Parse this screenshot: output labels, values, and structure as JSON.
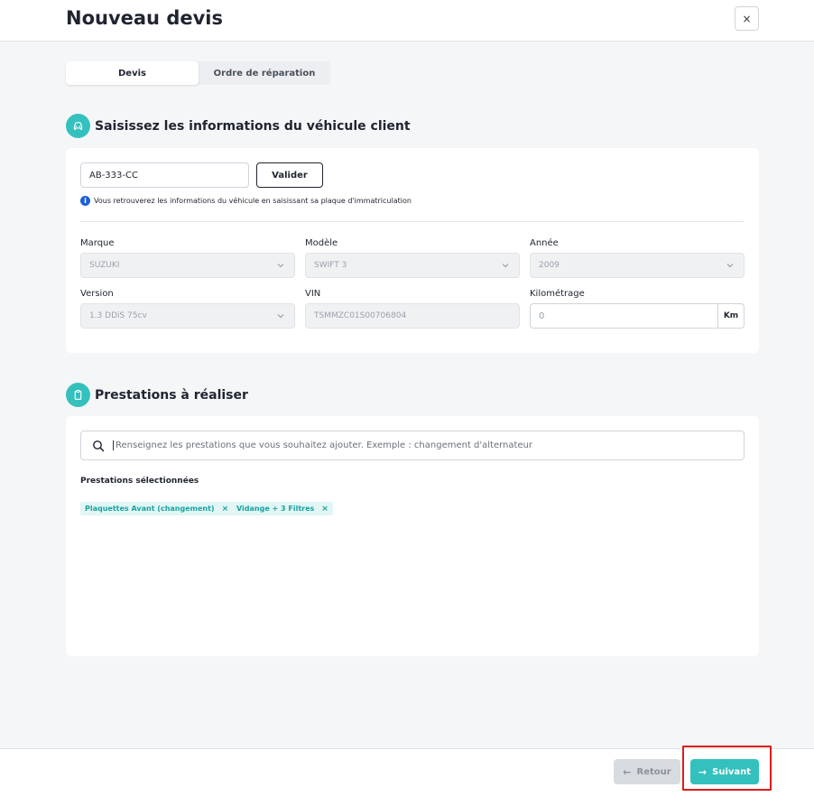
{
  "header": {
    "title": "Nouveau devis",
    "close_label": "×"
  },
  "tabs": [
    {
      "label": "Devis",
      "active": true
    },
    {
      "label": "Ordre de réparation",
      "active": false
    }
  ],
  "vehicle_section": {
    "title": "Saisissez les informations du véhicule client",
    "icon": "car-icon",
    "plate_value": "AB-333-CC",
    "validate_label": "Valider",
    "info_text": "Vous retrouverez les informations du véhicule en saisissant sa plaque d'immatriculation",
    "fields": {
      "marque": {
        "label": "Marque",
        "value": "SUZUKI"
      },
      "modele": {
        "label": "Modèle",
        "value": "SWIFT 3"
      },
      "annee": {
        "label": "Année",
        "value": "2009"
      },
      "version": {
        "label": "Version",
        "value": "1.3 DDiS 75cv"
      },
      "vin": {
        "label": "VIN",
        "value": "TSMMZC01S00706804"
      },
      "kilometrage": {
        "label": "Kilométrage",
        "value": "0",
        "unit": "Km"
      }
    }
  },
  "services_section": {
    "title": "Prestations à réaliser",
    "icon": "clipboard-icon",
    "search_placeholder": "Renseignez les prestations que vous souhaitez ajouter. Exemple : changement d'alternateur",
    "selected_label": "Prestations sélectionnées",
    "selected": [
      {
        "label": "Plaquettes Avant (changement)"
      },
      {
        "label": "Vidange + 3 Filtres"
      }
    ],
    "remove_glyph": "×"
  },
  "footer": {
    "back_label": "Retour",
    "next_label": "Suivant"
  },
  "colors": {
    "accent": "#34c1be",
    "chip_bg": "#e1f6f5",
    "highlight": "#e01b1b",
    "info": "#1d5fd6"
  }
}
